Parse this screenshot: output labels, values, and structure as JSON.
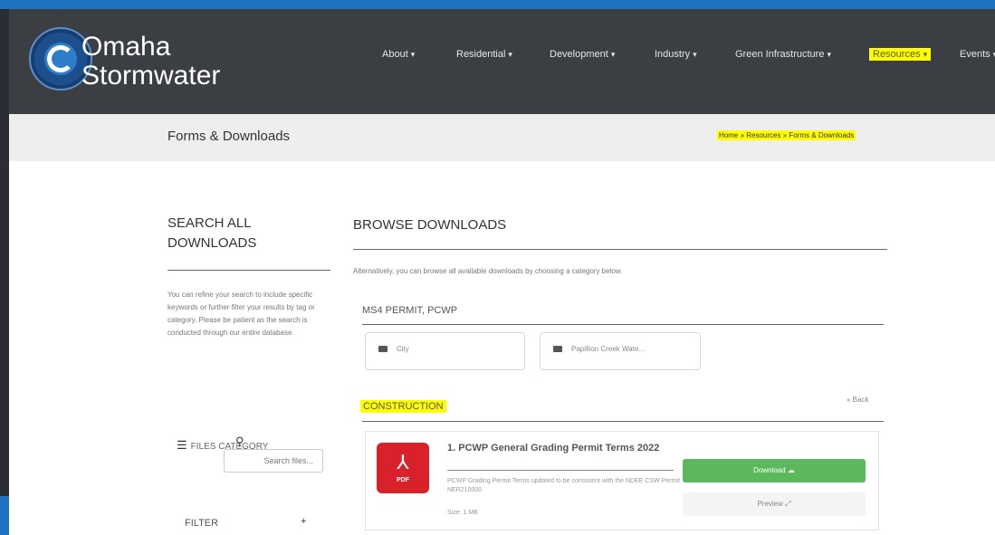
{
  "brand": {
    "line1": "Omaha",
    "line2": "Stormwater"
  },
  "nav": {
    "items": [
      {
        "label": "About"
      },
      {
        "label": "Residential"
      },
      {
        "label": "Development"
      },
      {
        "label": "Industry"
      },
      {
        "label": "Green Infrastructure"
      },
      {
        "label": "Resources"
      },
      {
        "label": "Events"
      }
    ],
    "active": "Resources",
    "highlight_color": "#ffff00"
  },
  "titlebar": {
    "title": "Forms & Downloads",
    "breadcrumb": "Home » Resources » Forms & Downloads"
  },
  "sidebar": {
    "heading": "SEARCH ALL DOWNLOADS",
    "description": "You can refine your search to include specific keywords or further filter your results by tag or category. Please be patient as the search is conducted through our entire database.",
    "files_category_label": "FILES CATEGORY",
    "search_placeholder": "Search files...",
    "filter_label": "FILTER"
  },
  "browse": {
    "heading": "BROWSE DOWNLOADS",
    "description": "Alternatively, you can browse all available downloads by choosing a category below.",
    "category_title": "MS4 PERMIT, PCWP",
    "categories": [
      {
        "label": "City"
      },
      {
        "label": "Papillion Creek Wate..."
      }
    ],
    "section": "CONSTRUCTION",
    "back_label": "« Back",
    "item": {
      "title": "1. PCWP General Grading Permit Terms 2022",
      "description": "PCWP Grading Permit Terms updated to be consistent with the NDEE CSW Permit NER210000",
      "size": "Size: 1 MB",
      "file_type": "PDF",
      "download_label": "Download",
      "preview_label": "Preview"
    }
  },
  "colors": {
    "header_bg": "#3b3f44",
    "frame_blue": "#1f72c2",
    "download_green": "#5cb85c",
    "pdf_red": "#d9212c"
  }
}
